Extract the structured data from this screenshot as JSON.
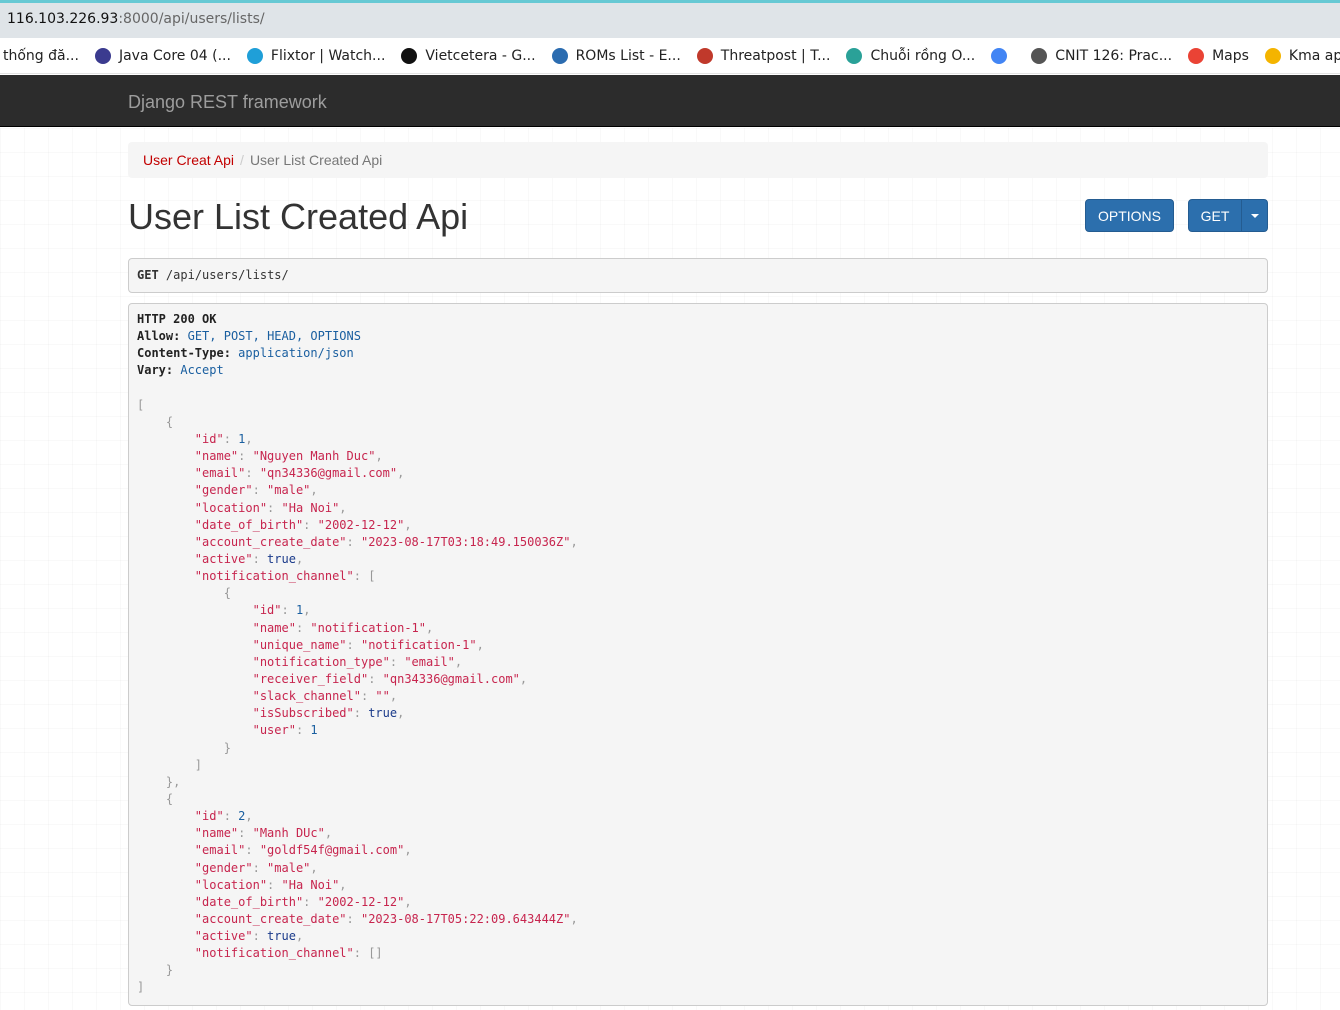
{
  "browser": {
    "url_host": "116.103.226.93",
    "url_path": ":8000/api/users/lists/",
    "bookmarks": [
      {
        "label": "thống đă...",
        "icon": "none",
        "color": "#ffffff"
      },
      {
        "label": "Java Core 04 (...",
        "icon": "s-icon",
        "color": "#3b3b8f"
      },
      {
        "label": "Flixtor | Watch...",
        "icon": "flixtor-icon",
        "color": "#1f9fd8"
      },
      {
        "label": "Vietcetera - G...",
        "icon": "v-icon",
        "color": "#111111"
      },
      {
        "label": "ROMs List - E...",
        "icon": "c-icon",
        "color": "#2b6cb0"
      },
      {
        "label": "Threatpost | T...",
        "icon": "tp-icon",
        "color": "#c0392b"
      },
      {
        "label": "Chuỗi rồng O...",
        "icon": "wave-icon",
        "color": "#2aa198"
      },
      {
        "label": "",
        "icon": "google-icon",
        "color": "#4285f4"
      },
      {
        "label": "CNIT 126: Prac...",
        "icon": "penguin-icon",
        "color": "#555555"
      },
      {
        "label": "Maps",
        "icon": "maps-pin-icon",
        "color": "#ea4335"
      },
      {
        "label": "Kma app c",
        "icon": "firebase-icon",
        "color": "#f4b400"
      }
    ]
  },
  "navbar": {
    "brand": "Django REST framework"
  },
  "breadcrumb": {
    "parent": "User Creat Api",
    "separator": "/",
    "current": "User List Created Api"
  },
  "page": {
    "title": "User List Created Api"
  },
  "buttons": {
    "options": "OPTIONS",
    "get": "GET"
  },
  "request": {
    "method": "GET",
    "path": "/api/users/lists/"
  },
  "response": {
    "status": "HTTP 200 OK",
    "headers": [
      {
        "name": "Allow:",
        "value": "GET, POST, HEAD, OPTIONS"
      },
      {
        "name": "Content-Type:",
        "value": "application/json"
      },
      {
        "name": "Vary:",
        "value": "Accept"
      }
    ],
    "users": [
      {
        "id": "1",
        "name": "\"Nguyen Manh Duc\"",
        "email": "\"qn34336@gmail.com\"",
        "gender": "\"male\"",
        "location": "\"Ha Noi\"",
        "date_of_birth": "\"2002-12-12\"",
        "account_create_date": "\"2023-08-17T03:18:49.150036Z\"",
        "active": "true",
        "notification_channel": [
          {
            "id": "1",
            "name": "\"notification-1\"",
            "unique_name": "\"notification-1\"",
            "notification_type": "\"email\"",
            "receiver_field": "\"qn34336@gmail.com\"",
            "slack_channel": "\"\"",
            "isSubscribed": "true",
            "user": "1"
          }
        ]
      },
      {
        "id": "2",
        "name": "\"Manh DUc\"",
        "email": "\"goldf54f@gmail.com\"",
        "gender": "\"male\"",
        "location": "\"Ha Noi\"",
        "date_of_birth": "\"2002-12-12\"",
        "account_create_date": "\"2023-08-17T05:22:09.643444Z\"",
        "active": "true",
        "notification_channel": "[]"
      }
    ]
  }
}
